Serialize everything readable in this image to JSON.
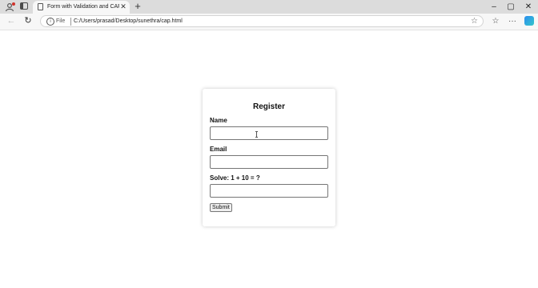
{
  "browser": {
    "tab_title": "Form with Validation and CAPTCHA",
    "tab_close": "✕",
    "new_tab": "+",
    "window_controls": {
      "minimize": "–",
      "maximize": "▢",
      "close": "✕"
    },
    "back": "←",
    "reload": "↻",
    "file_label": "File",
    "url": "C:/Users/prasad/Desktop/sunethra/cap.html",
    "favorite": "☆",
    "collections": "☆",
    "more": "···"
  },
  "form": {
    "title": "Register",
    "name_label": "Name",
    "name_value": "",
    "email_label": "Email",
    "email_value": "",
    "captcha_label": "Solve: 1 + 10 = ?",
    "captcha_value": "",
    "submit_label": "Submit"
  }
}
